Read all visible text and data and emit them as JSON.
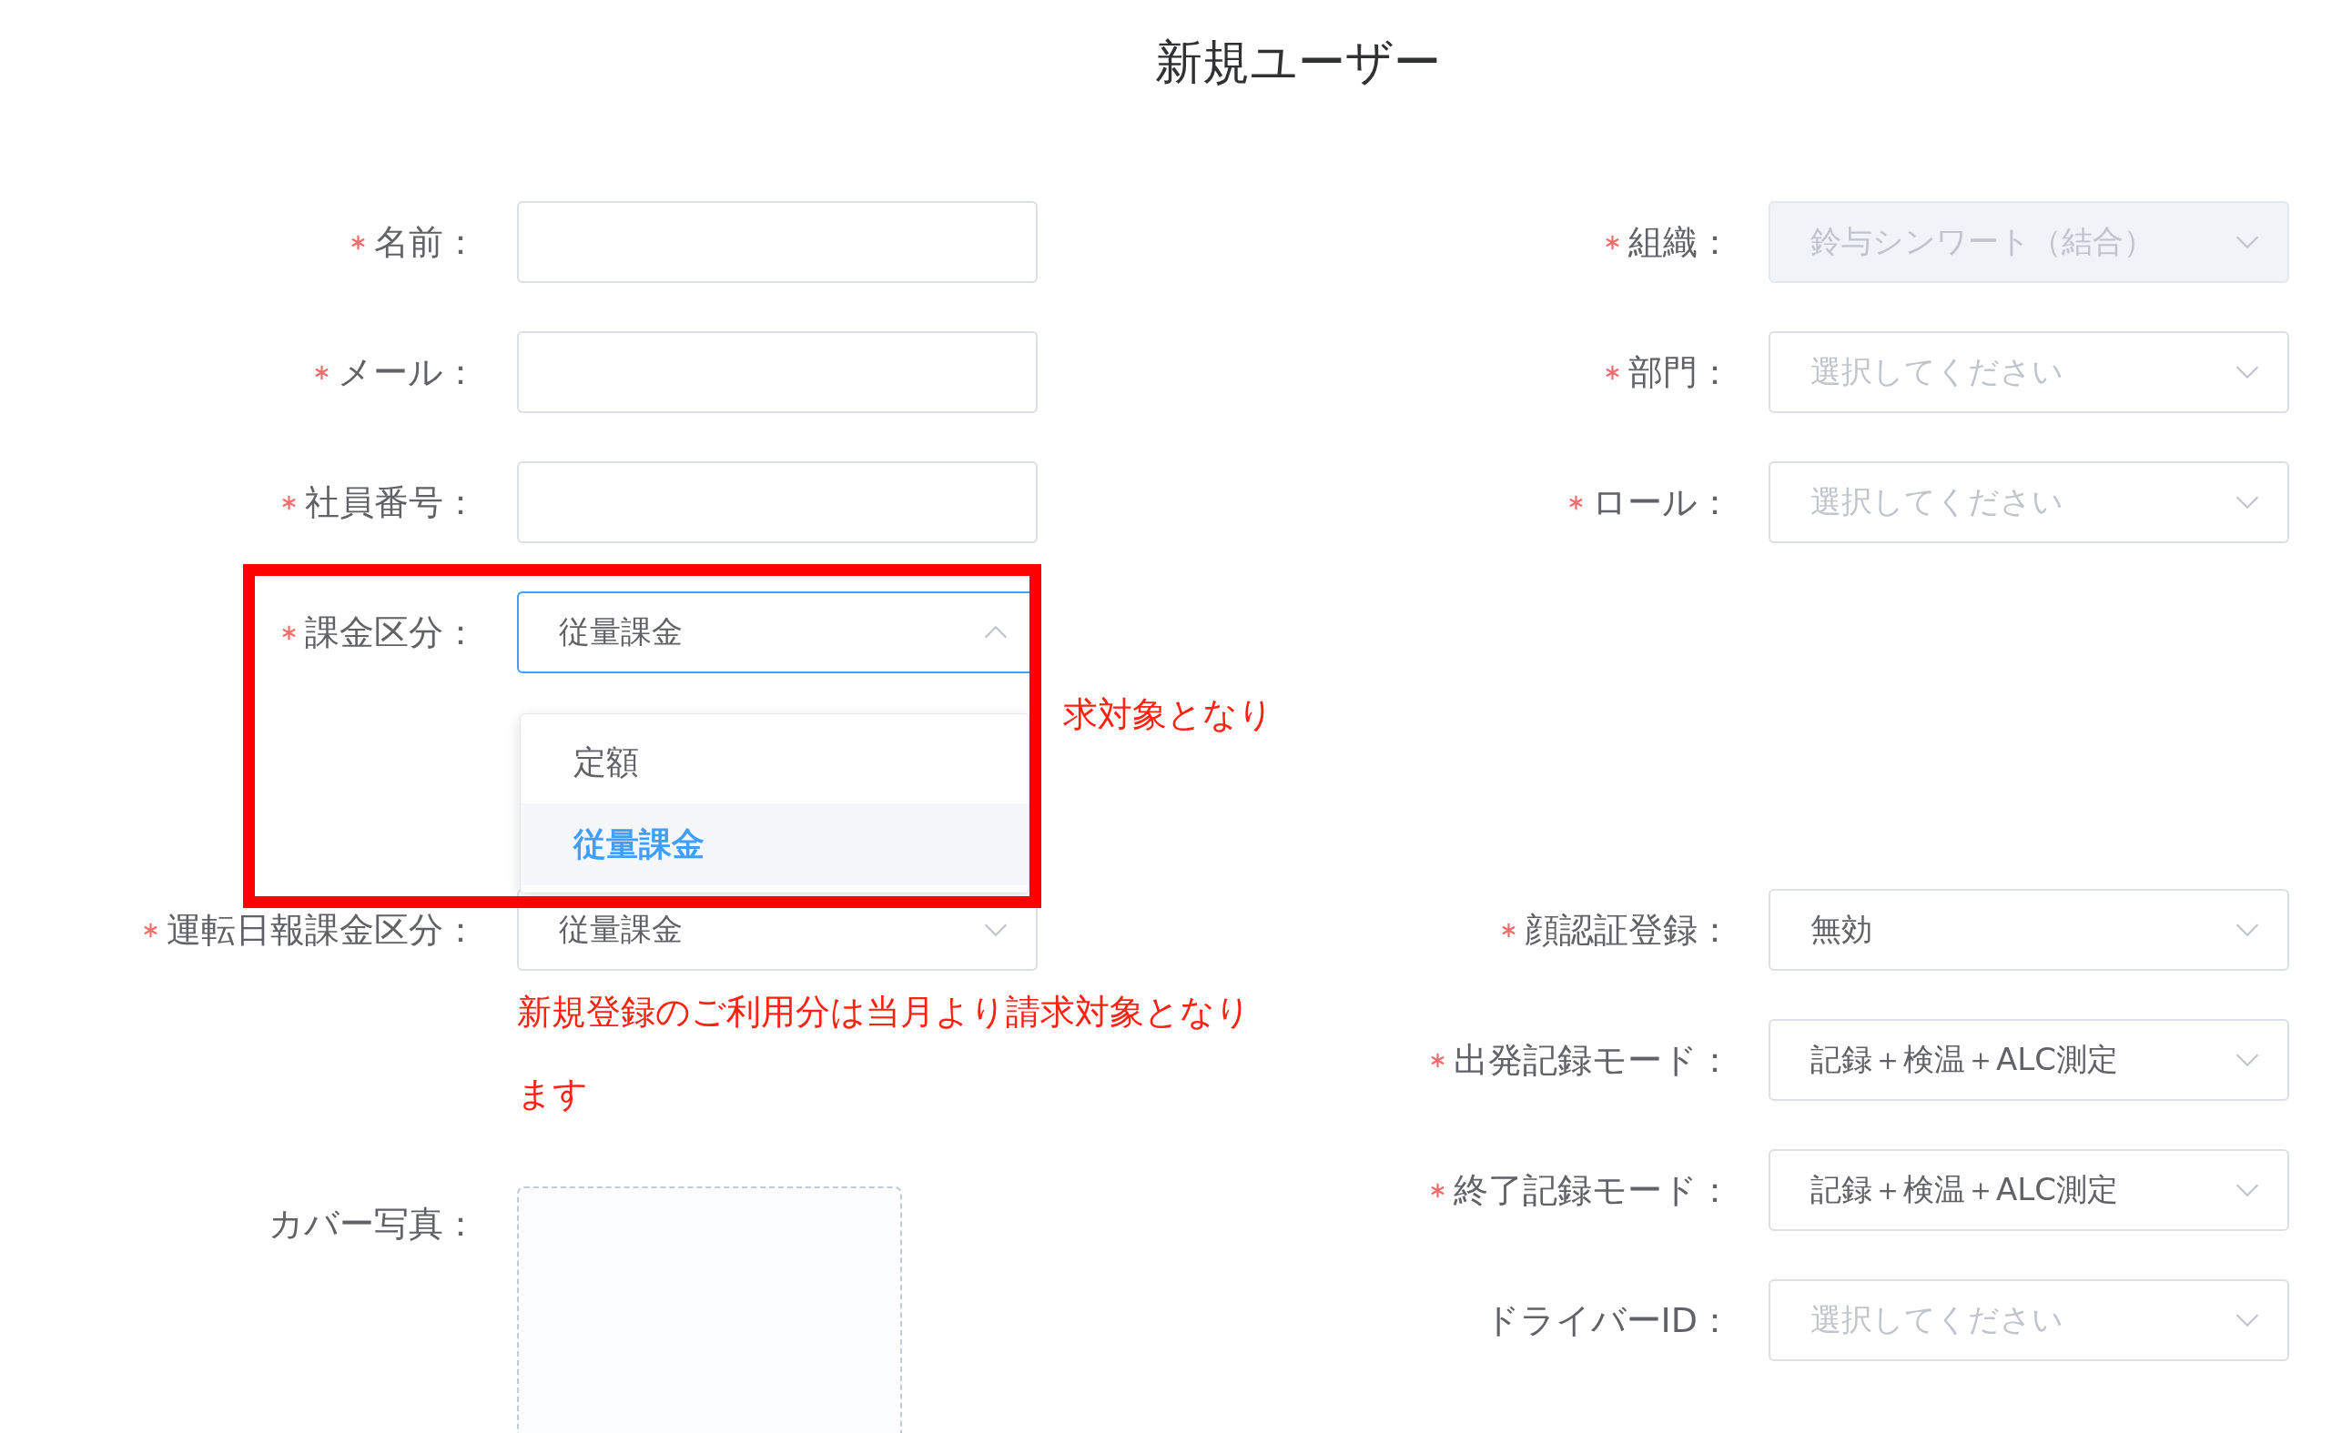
{
  "title": "新規ユーザー",
  "left_fields": [
    {
      "label": "名前：",
      "required": true,
      "kind": "input"
    },
    {
      "label": "メール：",
      "required": true,
      "kind": "input"
    },
    {
      "label": "社員番号：",
      "required": true,
      "kind": "input"
    },
    {
      "label": "課金区分：",
      "required": true,
      "kind": "select",
      "value": "従量課金",
      "expanded": true,
      "note": "求対象となり"
    },
    {
      "label": "運転日報課金区分：",
      "required": true,
      "kind": "select",
      "value": "従量課金",
      "expanded": false,
      "note": "新規登録のご利用分は当月より請求対象となります"
    },
    {
      "label": "カバー写真：",
      "required": false,
      "kind": "upload"
    }
  ],
  "right_sections": [
    {
      "fields": [
        {
          "label": "組織：",
          "required": true,
          "value": "鈴与シンワート（結合）",
          "disabled": true
        },
        {
          "label": "部門：",
          "required": true,
          "placeholder": "選択してください",
          "disabled": false
        },
        {
          "label": "ロール：",
          "required": true,
          "placeholder": "選択してください",
          "disabled": false
        }
      ]
    },
    {
      "fields": [
        {
          "label": "顔認証登録：",
          "required": true,
          "value": "無効",
          "disabled": false
        },
        {
          "label": "出発記録モード：",
          "required": true,
          "value": "記録＋検温＋ALC測定",
          "disabled": false
        },
        {
          "label": "終了記録モード：",
          "required": true,
          "value": "記録＋検温＋ALC測定",
          "disabled": false
        },
        {
          "label": "ドライバーID：",
          "required": false,
          "placeholder": "選択してください",
          "disabled": false
        }
      ]
    }
  ],
  "dropdown": {
    "options": [
      {
        "label": "定額",
        "selected": false
      },
      {
        "label": "従量課金",
        "selected": true
      }
    ]
  },
  "annotation": {
    "kind": "highlight-frame"
  }
}
